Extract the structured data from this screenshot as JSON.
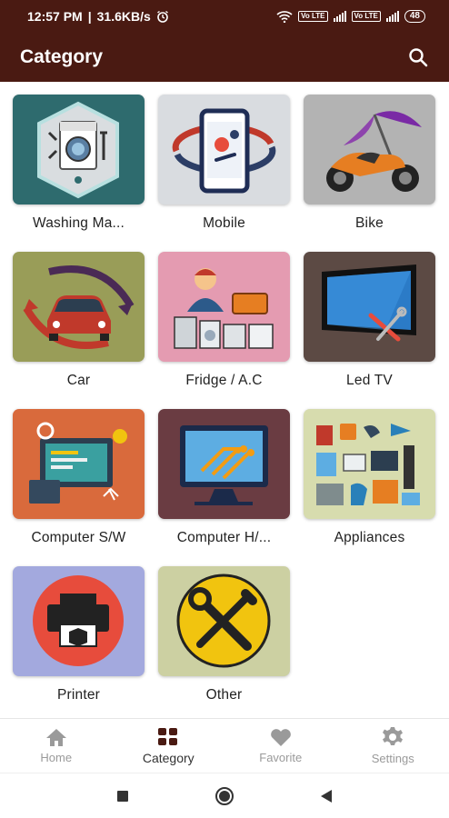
{
  "status_bar": {
    "time": "12:57 PM",
    "speed": "31.6KB/s",
    "sim1": "Vo LTE",
    "sim2": "Vo LTE",
    "battery": "48"
  },
  "app_bar": {
    "title": "Category"
  },
  "categories": [
    {
      "label": "Washing Ma...",
      "bg": "#2e6b6e"
    },
    {
      "label": "Mobile",
      "bg": "#d9dce0"
    },
    {
      "label": "Bike",
      "bg": "#b3b3b3"
    },
    {
      "label": "Car",
      "bg": "#999d58"
    },
    {
      "label": "Fridge / A.C",
      "bg": "#e49bb1"
    },
    {
      "label": "Led TV",
      "bg": "#5c4a44"
    },
    {
      "label": "Computer S/W",
      "bg": "#d96a3c"
    },
    {
      "label": "Computer H/...",
      "bg": "#6a3c42"
    },
    {
      "label": "Appliances",
      "bg": "#d7dcae"
    },
    {
      "label": "Printer",
      "bg": "#a3a9de"
    },
    {
      "label": "Other",
      "bg": "#ccd0a2"
    }
  ],
  "bottom_nav": [
    {
      "label": "Home",
      "icon": "home-icon"
    },
    {
      "label": "Category",
      "icon": "grid-icon",
      "active": true
    },
    {
      "label": "Favorite",
      "icon": "heart-icon"
    },
    {
      "label": "Settings",
      "icon": "gear-icon"
    }
  ],
  "colors": {
    "app_bar": "#4a1a12",
    "active_nav": "#4a1a12",
    "inactive_nav": "#9a9a9a"
  }
}
